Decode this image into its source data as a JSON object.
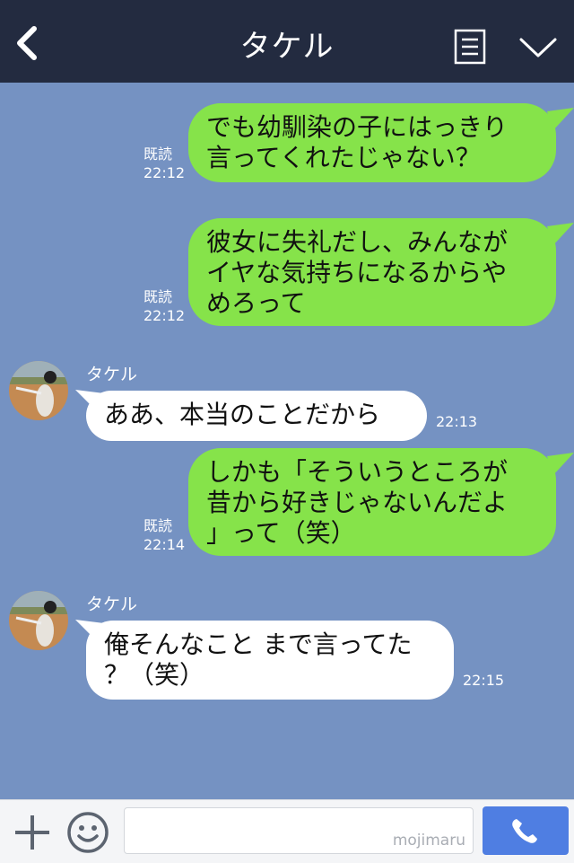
{
  "header": {
    "title": "タケル"
  },
  "messages": [
    {
      "dir": "out",
      "text": "でも幼馴染の子にはっきり\n言ってくれたじゃない？",
      "read": "既読",
      "time": "22:12"
    },
    {
      "dir": "out",
      "text": "彼女に失礼だし、みんなが\nイヤな気持ちになるからや\nめろって",
      "read": "既読",
      "time": "22:12"
    },
    {
      "dir": "in",
      "sender": "タケル",
      "text": "ああ、本当のことだから",
      "time": "22:13"
    },
    {
      "dir": "out",
      "text": "しかも「そういうところが\n昔から好きじゃないんだよ\n」って（笑）",
      "read": "既読",
      "time": "22:14"
    },
    {
      "dir": "in",
      "sender": "タケル",
      "text": "俺そんなこと まで言ってた\n？（笑）",
      "time": "22:15"
    }
  ],
  "composer": {
    "watermark": "mojimaru"
  },
  "colors": {
    "header": "#232b40",
    "chat_bg": "#7592c2",
    "outgoing": "#86e34a",
    "incoming": "#ffffff",
    "call": "#4f7ee2"
  },
  "icons": {
    "back": "chevron-left-icon",
    "menu": "menu-icon",
    "collapse": "chevron-down-icon",
    "add": "plus-icon",
    "emoji": "smiley-icon",
    "call": "phone-icon"
  }
}
